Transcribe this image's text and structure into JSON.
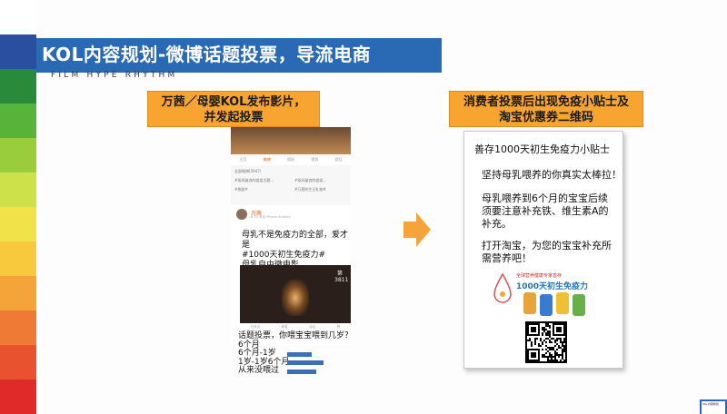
{
  "slide": {
    "title": "KOL内容规划-微博话题投票，导流电商",
    "subtitle": "FILM HYPE RHYTHM",
    "stripe_colors": [
      "#ffffff",
      "#2a4fa0",
      "#2a8a3c",
      "#58b33a",
      "#9acd3c",
      "#cde24a",
      "#f2e24a",
      "#f8c93c",
      "#f5a43a",
      "#ef7a36",
      "#e8522e",
      "#e02a2a"
    ]
  },
  "left_panel": {
    "header": "万茜／母婴KOL发布影片，\n并发起投票",
    "phone": {
      "tabs": [
        "主页",
        "微博",
        "相册",
        "视频",
        "超话"
      ],
      "lines": [
        "全部微博(3947)",
        "#乘风破浪的姐姐主题...",
        "#乘风破浪的姐姐...",
        "#热剧#",
        "#万茜的生日礼物#"
      ],
      "user_name": "万茜",
      "user_meta": "6-10 来自 iPhone Android"
    },
    "post_text": "母乳不是免疫力的全部，爱才是\n#1000天初生免疫力#\n母乳自由微电影",
    "video_caption": "第3811",
    "video_bar": [
      "已关注",
      "转发",
      "评论",
      "赞"
    ],
    "poll": {
      "question": "话题投票，你喂宝宝喂到几岁？",
      "options": [
        "6个月",
        "6个月-1岁",
        "1岁-1岁6个月",
        "从来没喂过"
      ],
      "shares": [
        0,
        0.62,
        0.92,
        0.72
      ]
    }
  },
  "right_panel": {
    "header": "消费者投票后出现免疫小贴士及\n淘宝优惠券二维码",
    "card": {
      "tip_title": "善存1000天初生免疫力小贴士",
      "tip_1": "坚持母乳喂养的你真实太棒拉！",
      "tip_2": "母乳喂养到6个月的宝宝后续\n须要注意补充铁、维生素A的\n补充。",
      "tip_3": "打开淘宝，为您的宝宝补充所\n需营养吧！",
      "promo_title": "全球营养健康专家善存",
      "promo_number": "1000天初生免疫力"
    }
  },
  "thumbnail": {
    "text": "KOL内容规划"
  },
  "colors": {
    "banner": "#2a6ab4",
    "orange": "#f8a431",
    "poll_bar": "#3c6fb8"
  }
}
